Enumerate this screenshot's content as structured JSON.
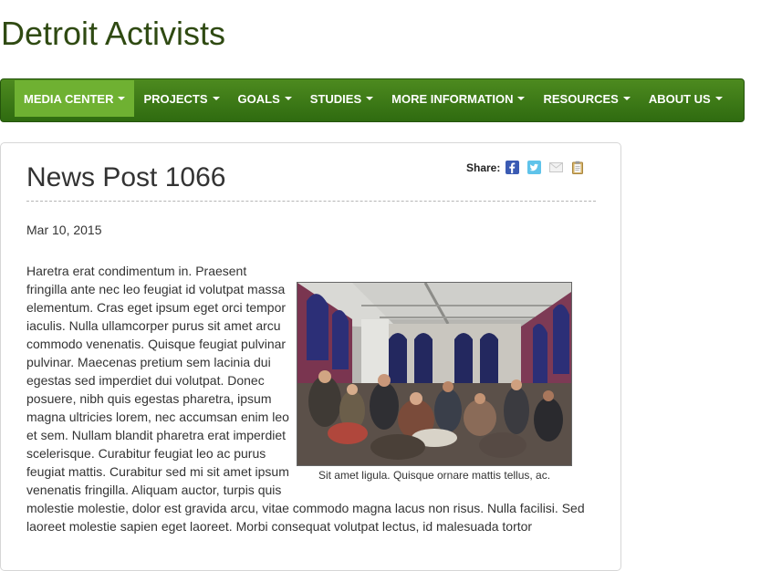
{
  "site": {
    "title": "Detroit Activists"
  },
  "nav": {
    "items": [
      {
        "label": "MEDIA CENTER",
        "active": true
      },
      {
        "label": "PROJECTS"
      },
      {
        "label": "GOALS"
      },
      {
        "label": "STUDIES"
      },
      {
        "label": "MORE INFORMATION"
      },
      {
        "label": "RESOURCES"
      },
      {
        "label": "ABOUT US"
      }
    ]
  },
  "post": {
    "title": "News Post 1066",
    "date": "Mar 10, 2015",
    "body": "Haretra erat condimentum in. Praesent fringilla ante nec leo feugiat id volutpat massa elementum. Cras eget ipsum eget orci tempor iaculis. Nulla ullamcorper purus sit amet arcu commodo venenatis. Quisque feugiat pulvinar pulvinar. Maecenas pretium sem lacinia dui egestas sed imperdiet dui volutpat. Donec posuere, nibh quis egestas pharetra, ipsum magna ultricies lorem, nec accumsan enim leo et sem. Nullam blandit pharetra erat imperdiet scelerisque. Curabitur feugiat leo ac purus feugiat mattis. Curabitur sed mi sit amet ipsum venenatis fringilla. Aliquam auctor, turpis quis molestie molestie, dolor est gravida arcu, vitae commodo magna lacus non risus. Nulla facilisi. Sed laoreet molestie sapien eget laoreet. Morbi consequat volutpat lectus, id malesuada tortor",
    "image_caption": "Sit amet ligula. Quisque ornare mattis tellus, ac."
  },
  "share": {
    "label": "Share:",
    "icons": [
      "facebook-icon",
      "twitter-icon",
      "email-icon",
      "clipboard-icon"
    ]
  },
  "colors": {
    "title": "#2f4a12",
    "nav_bg": "#3d7a18",
    "nav_active": "#6fb132"
  }
}
